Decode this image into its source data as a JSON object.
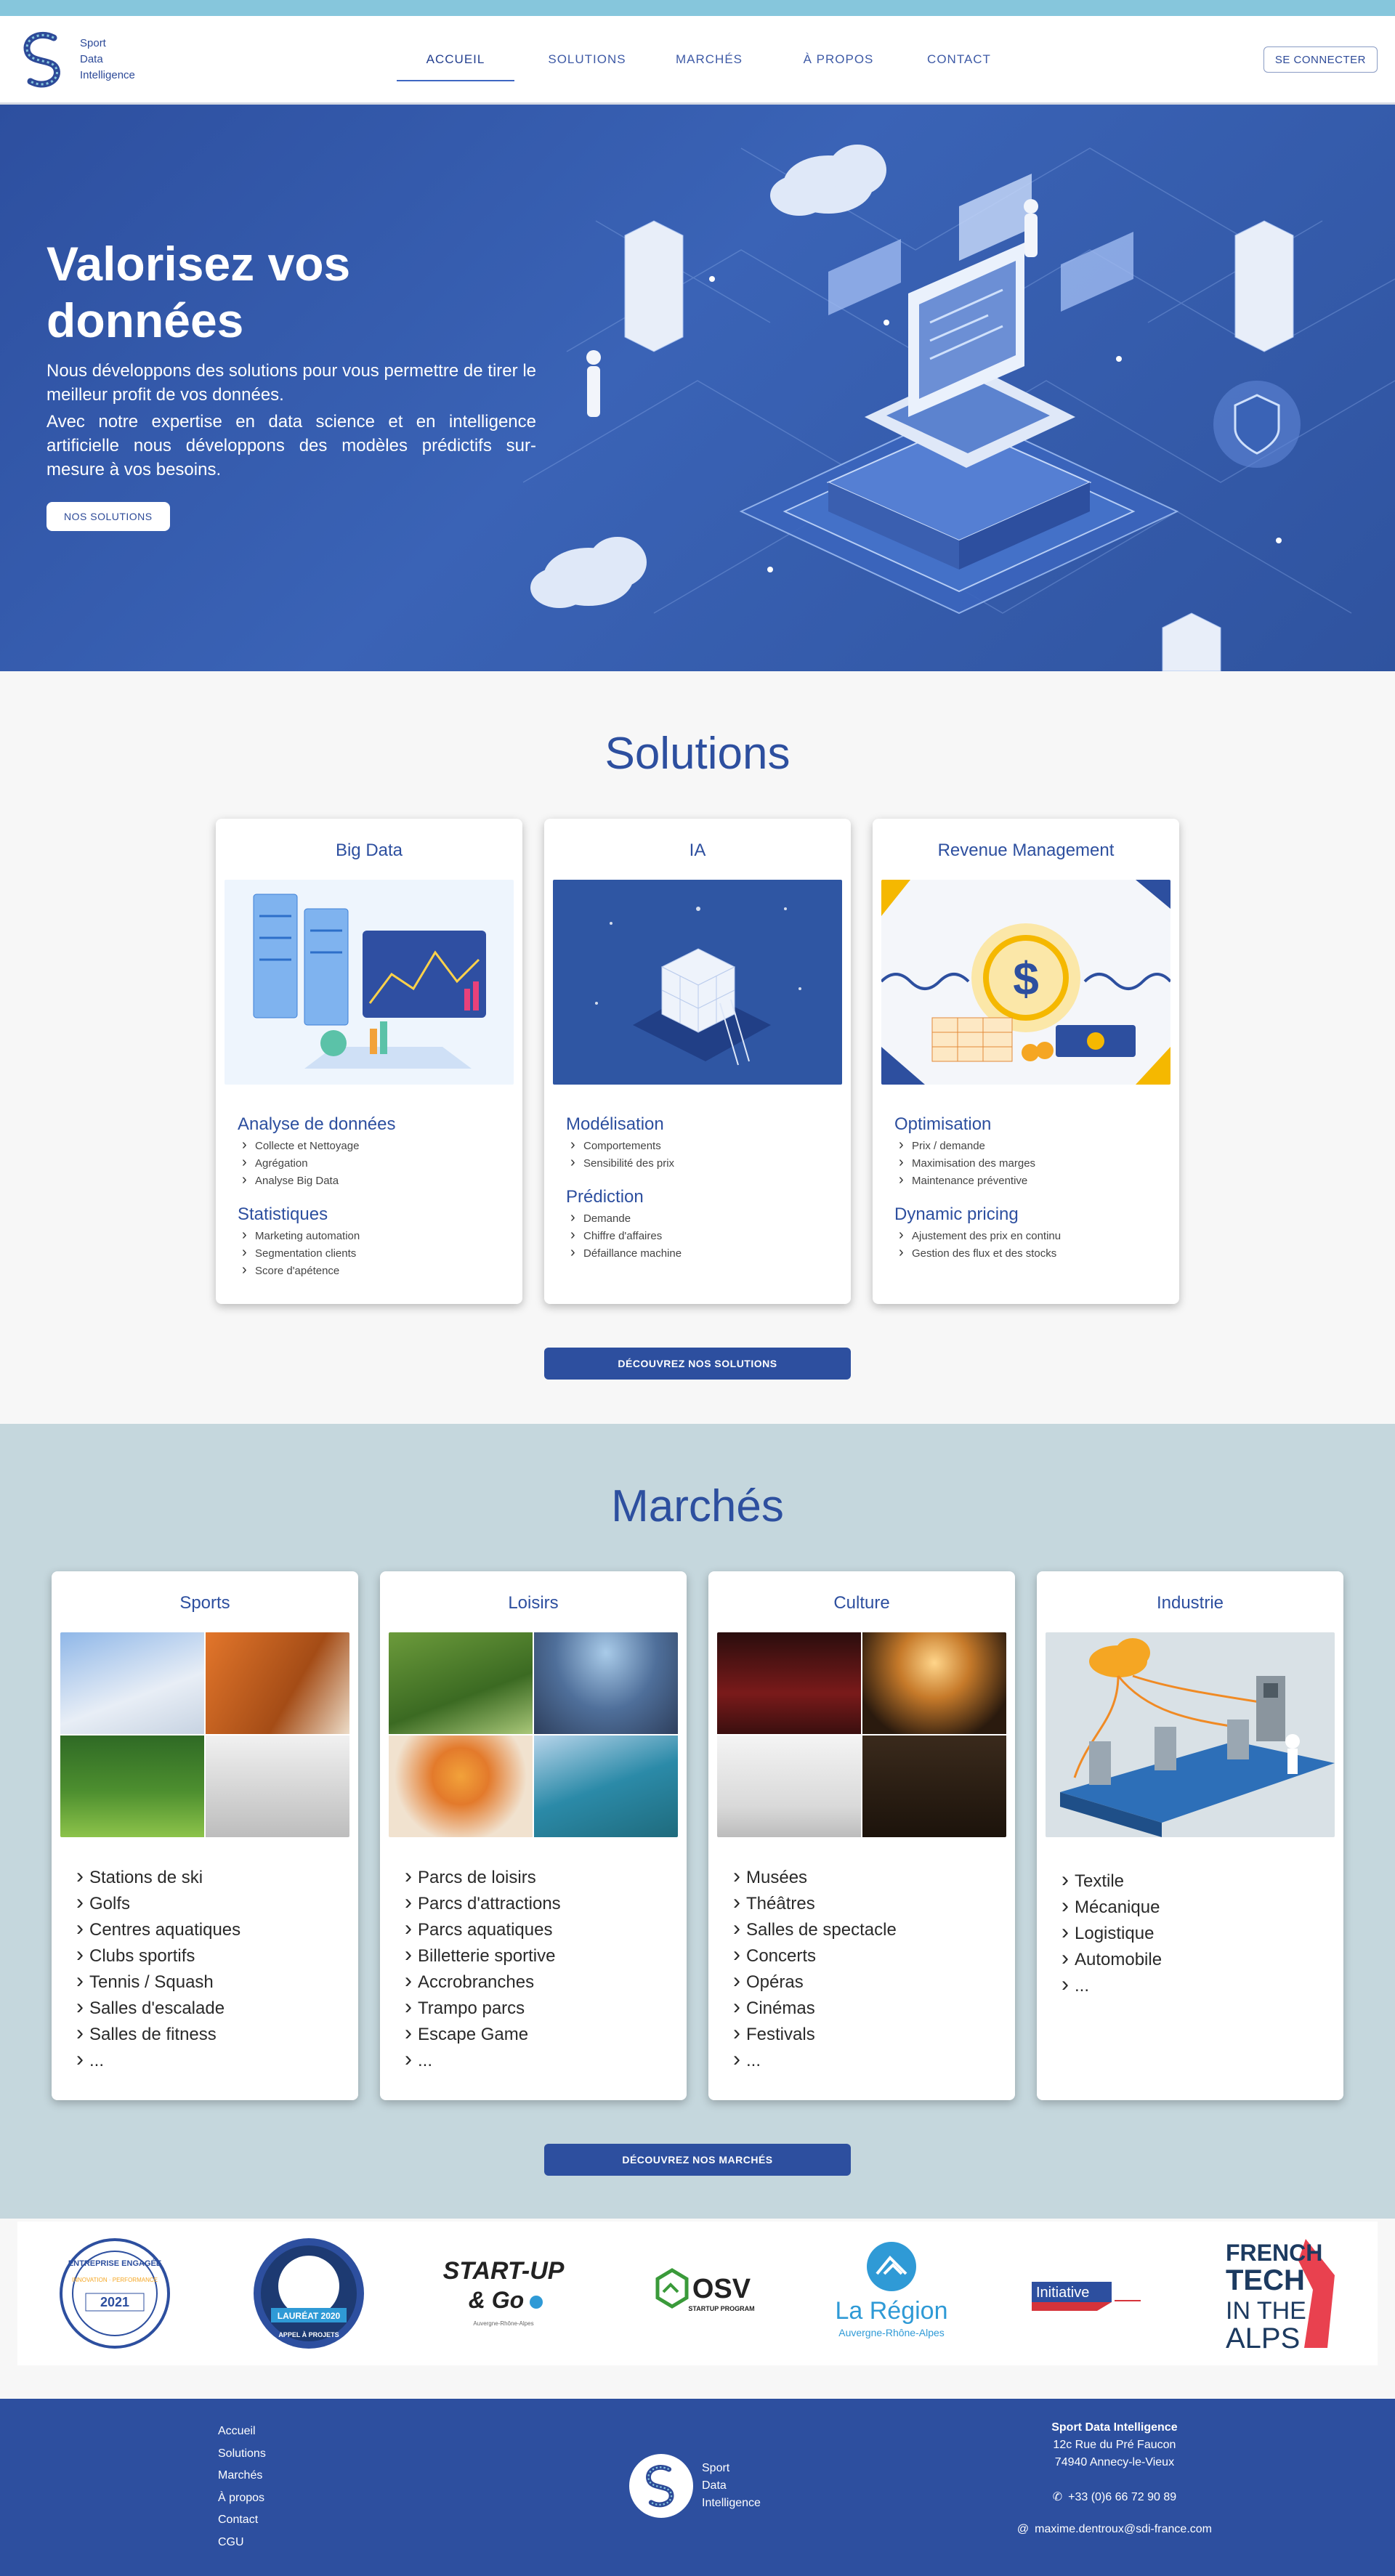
{
  "brand": {
    "line1": "Sport",
    "line2": "Data",
    "line3": "Intelligence"
  },
  "nav": [
    {
      "label": "Accueil"
    },
    {
      "label": "Solutions"
    },
    {
      "label": "Marchés"
    },
    {
      "label": "À propos"
    },
    {
      "label": "Contact"
    }
  ],
  "header": {
    "login_label": "SE CONNECTER"
  },
  "hero": {
    "title": "Valorisez vos données",
    "p1": "Nous développons des solutions pour vous permettre de tirer le meilleur profit de vos données.",
    "p2": "Avec notre expertise en data science et en intelligence artificielle nous développons des modèles prédictifs sur-mesure à vos besoins.",
    "button": "NOS SOLUTIONS"
  },
  "solutions": {
    "title": "Solutions",
    "cta": "DÉCOUVREZ NOS SOLUTIONS",
    "cards": [
      {
        "title": "Big Data",
        "groups": [
          {
            "heading": "Analyse de données",
            "items": [
              "Collecte et Nettoyage",
              "Agrégation",
              "Analyse Big Data"
            ]
          },
          {
            "heading": "Statistiques",
            "items": [
              "Marketing automation",
              "Segmentation clients",
              "Score d'apétence"
            ]
          }
        ]
      },
      {
        "title": "IA",
        "groups": [
          {
            "heading": "Modélisation",
            "items": [
              "Comportements",
              "Sensibilité des prix"
            ]
          },
          {
            "heading": "Prédiction",
            "items": [
              "Demande",
              "Chiffre d'affaires",
              "Défaillance machine"
            ]
          }
        ]
      },
      {
        "title": "Revenue Management",
        "groups": [
          {
            "heading": "Optimisation",
            "items": [
              "Prix / demande",
              "Maximisation des marges",
              "Maintenance préventive"
            ]
          },
          {
            "heading": "Dynamic pricing",
            "items": [
              "Ajustement des prix en continu",
              "Gestion des flux et des stocks"
            ]
          }
        ]
      }
    ]
  },
  "markets": {
    "title": "Marchés",
    "cta": "DÉCOUVREZ NOS MARCHÉS",
    "cards": [
      {
        "title": "Sports",
        "items": [
          "Stations de ski",
          "Golfs",
          "Centres aquatiques",
          "Clubs sportifs",
          "Tennis / Squash",
          "Salles d'escalade",
          "Salles de fitness",
          "..."
        ]
      },
      {
        "title": "Loisirs",
        "items": [
          "Parcs de loisirs",
          "Parcs d'attractions",
          "Parcs aquatiques",
          "Billetterie sportive",
          "Accrobranches",
          "Trampo parcs",
          "Escape Game",
          "..."
        ]
      },
      {
        "title": "Culture",
        "items": [
          "Musées",
          "Théâtres",
          "Salles de spectacle",
          "Concerts",
          "Opéras",
          "Cinémas",
          "Festivals",
          "..."
        ]
      },
      {
        "title": "Industrie",
        "items": [
          "Textile",
          "Mécanique",
          "Logistique",
          "Automobile",
          "..."
        ]
      }
    ]
  },
  "partners": [
    {
      "name": "entreprise-engagee-2021-badge",
      "top": "ENTREPRISE ENGAGÉE",
      "year": "2021"
    },
    {
      "name": "laureat-2020-badge",
      "top": "LAURÉAT 2020",
      "bottom": "APPEL À PROJETS"
    },
    {
      "name": "start-up-and-go-logo",
      "l1": "START-UP",
      "l2": "& Go",
      "l3": "Auvergne-Rhône-Alpes"
    },
    {
      "name": "osv-logo",
      "l1": "OSV",
      "l2": "STARTUP PROGRAM"
    },
    {
      "name": "la-region-logo",
      "l1": "La Région",
      "l2": "Auvergne-Rhône-Alpes"
    },
    {
      "name": "initiative-logo",
      "l1": "Initiative"
    },
    {
      "name": "french-tech-alps-logo",
      "l1": "FRENCH",
      "l2": "TECH",
      "l3": "IN THE",
      "l4": "ALPS"
    }
  ],
  "footer": {
    "links": [
      "Accueil",
      "Solutions",
      "Marchés",
      "À propos",
      "Contact",
      "CGU"
    ],
    "company": "Sport Data Intelligence",
    "street": "12c Rue du Pré Faucon",
    "city": "74940 Annecy-le-Vieux",
    "phone": "+33 (0)6 66 72 90 89",
    "email": "maxime.dentroux@sdi-france.com"
  },
  "colors": {
    "primary": "#2d4f9f",
    "markets_bg": "#c5d7dd",
    "top_strip": "#86c6dc"
  }
}
